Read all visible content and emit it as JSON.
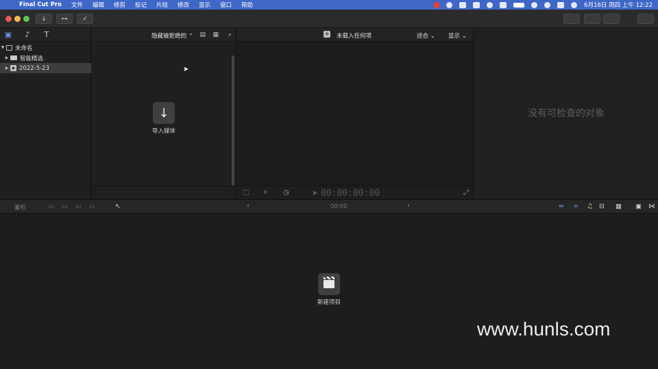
{
  "menubar": {
    "app_name": "Final Cut Pro",
    "items": [
      "文件",
      "编辑",
      "修剪",
      "标记",
      "片段",
      "修改",
      "显示",
      "窗口",
      "帮助"
    ],
    "clock": "6月16日 周四 上午 12:22"
  },
  "toolbar": {
    "import_icon": "↓",
    "keyword_icon": "⊶",
    "background_tasks_icon": "✓"
  },
  "library": {
    "rows": [
      {
        "label": "未命名",
        "kind": "library"
      },
      {
        "label": "智能精选",
        "kind": "folder"
      },
      {
        "label": "2022-5-23",
        "kind": "event",
        "selected": true
      }
    ]
  },
  "browser": {
    "filter": "隐藏被拒绝的 ⌃",
    "import_icon": "↓",
    "import_label": "导入媒体"
  },
  "viewer": {
    "title": "未载入任何项",
    "fit": "适合 ⌄",
    "show": "显示 ⌄",
    "timecode": "00:00:00:00"
  },
  "inspector": {
    "empty_message": "没有可检查的对象"
  },
  "timeline": {
    "index_label": "索引",
    "timecode": "00:00",
    "prev": "‹",
    "next": "›",
    "new_project_label": "新建项目"
  },
  "watermark": "www.hunls.com"
}
